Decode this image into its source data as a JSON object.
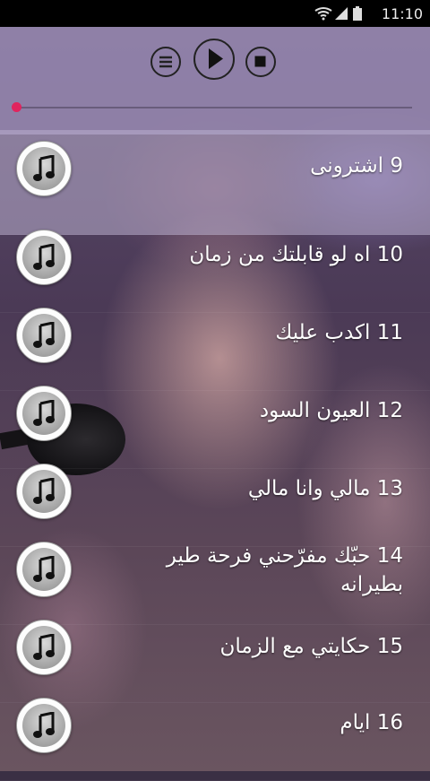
{
  "status": {
    "time": "11:10",
    "icons": [
      "wifi-icon",
      "signal-icon",
      "battery-icon"
    ]
  },
  "player": {
    "controls": [
      "menu-icon",
      "play-icon",
      "stop-icon"
    ],
    "progress": 0.0,
    "accent_color": "#e0245e"
  },
  "tracks": [
    {
      "title": "9 اشترونى",
      "icon": "music-note-icon"
    },
    {
      "title": "10 اه لو قابلتك من زمان",
      "icon": "music-note-icon"
    },
    {
      "title": "11 اكدب عليك",
      "icon": "music-note-icon"
    },
    {
      "title": "12 العيون السود",
      "icon": "music-note-icon"
    },
    {
      "title": "13 مالي وانا مالي",
      "icon": "music-note-icon"
    },
    {
      "title": "14 حبّك مفرّحني فرحة طير بطيرانه",
      "icon": "music-note-icon"
    },
    {
      "title": "15 حكايتي مع الزمان",
      "icon": "music-note-icon"
    },
    {
      "title": "16 ايام",
      "icon": "music-note-icon"
    }
  ]
}
